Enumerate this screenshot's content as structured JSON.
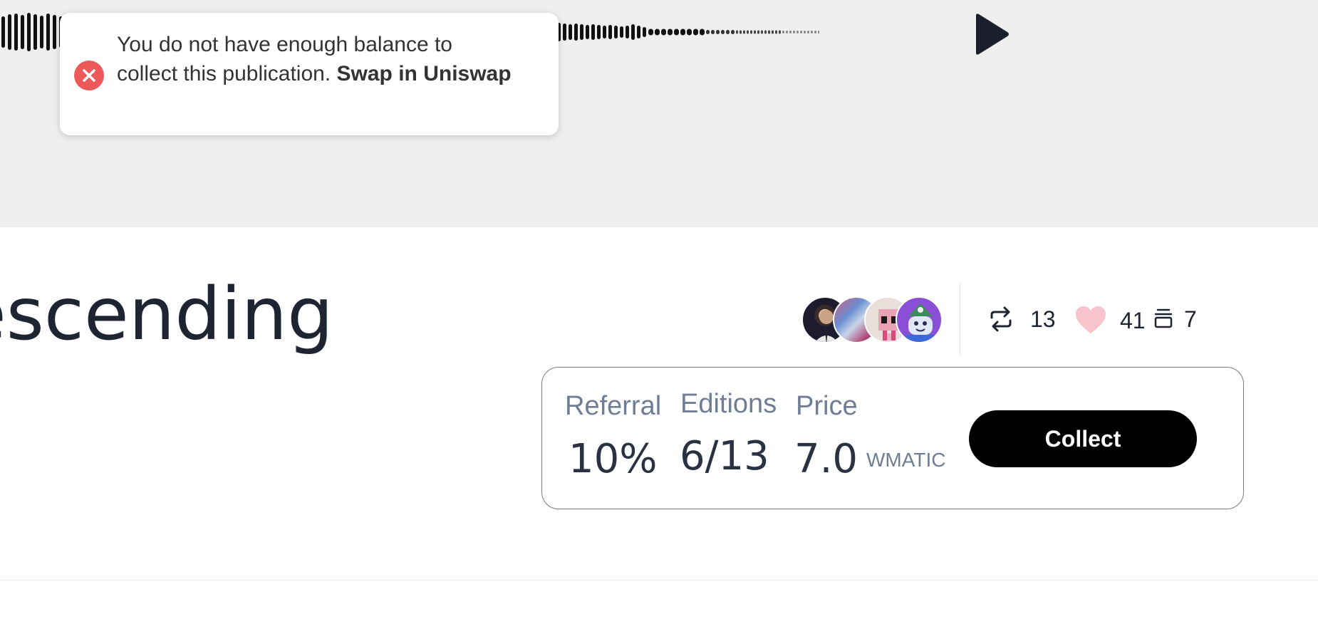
{
  "player": {
    "play_icon": "play-icon"
  },
  "toast": {
    "icon": "error-circle-icon",
    "message": "You do not have enough balance to collect this publication.",
    "link_label": "Swap in Uniswap"
  },
  "publication": {
    "title_fragment": "escending"
  },
  "stats": {
    "mirrors": "13",
    "likes": "41",
    "collects": "7"
  },
  "collect": {
    "referral_label": "Referral",
    "referral_value": "10%",
    "editions_label": "Editions",
    "editions_value": "6/13",
    "price_label": "Price",
    "price_value": "7.0",
    "price_unit": "WMATIC",
    "button_label": "Collect"
  },
  "colors": {
    "accent": "#000000",
    "error": "#ed5959",
    "like": "#f7c4cd",
    "label": "#6f7d95"
  }
}
